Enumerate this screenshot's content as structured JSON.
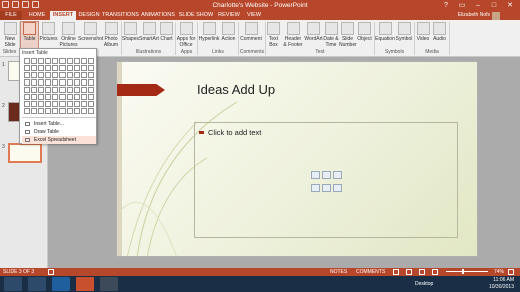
{
  "window": {
    "title": "Charlotte's Website - PowerPoint"
  },
  "tabs": [
    {
      "label": "FILE"
    },
    {
      "label": "HOME"
    },
    {
      "label": "INSERT"
    },
    {
      "label": "DESIGN"
    },
    {
      "label": "TRANSITIONS"
    },
    {
      "label": "ANIMATIONS"
    },
    {
      "label": "SLIDE SHOW"
    },
    {
      "label": "REVIEW"
    },
    {
      "label": "VIEW"
    }
  ],
  "active_tab": "INSERT",
  "user": {
    "name": "Elizabeth Nofs"
  },
  "ribbon": {
    "buttons": [
      {
        "label": "New\nSlide",
        "icon": "new-slide-icon"
      },
      {
        "label": "Table",
        "icon": "table-icon"
      },
      {
        "label": "Pictures",
        "icon": "pictures-icon"
      },
      {
        "label": "Online\nPictures",
        "icon": "online-pictures-icon"
      },
      {
        "label": "Screenshot",
        "icon": "screenshot-icon"
      },
      {
        "label": "Photo\nAlbum",
        "icon": "photo-album-icon"
      },
      {
        "label": "Shapes",
        "icon": "shapes-icon"
      },
      {
        "label": "SmartArt",
        "icon": "smartart-icon"
      },
      {
        "label": "Chart",
        "icon": "chart-icon"
      },
      {
        "label": "Apps for\nOffice",
        "icon": "apps-icon"
      },
      {
        "label": "Hyperlink",
        "icon": "hyperlink-icon"
      },
      {
        "label": "Action",
        "icon": "action-icon"
      },
      {
        "label": "Comment",
        "icon": "comment-icon"
      },
      {
        "label": "Text\nBox",
        "icon": "text-box-icon"
      },
      {
        "label": "Header\n& Footer",
        "icon": "header-footer-icon"
      },
      {
        "label": "WordArt",
        "icon": "wordart-icon"
      },
      {
        "label": "Date &\nTime",
        "icon": "date-time-icon"
      },
      {
        "label": "Slide\nNumber",
        "icon": "slide-number-icon"
      },
      {
        "label": "Object",
        "icon": "object-icon"
      },
      {
        "label": "Equation",
        "icon": "equation-icon"
      },
      {
        "label": "Symbol",
        "icon": "symbol-icon"
      },
      {
        "label": "Video",
        "icon": "video-icon"
      },
      {
        "label": "Audio",
        "icon": "audio-icon"
      }
    ],
    "groups": [
      {
        "label": "Slides"
      },
      {
        "label": "Images"
      },
      {
        "label": "Illustrations"
      },
      {
        "label": "Apps"
      },
      {
        "label": "Links"
      },
      {
        "label": "Comments"
      },
      {
        "label": "Text"
      },
      {
        "label": "Symbols"
      },
      {
        "label": "Media"
      }
    ]
  },
  "table_dropdown": {
    "header": "Insert Table",
    "grid_columns": 10,
    "grid_rows": 8,
    "items": [
      {
        "label": "Insert Table...",
        "icon": "insert-table-icon"
      },
      {
        "label": "Draw Table",
        "icon": "draw-table-icon"
      },
      {
        "label": "Excel Spreadsheet",
        "icon": "excel-spreadsheet-icon"
      }
    ]
  },
  "thumbnails": [
    {
      "number": "1"
    },
    {
      "number": "2"
    },
    {
      "number": "3"
    }
  ],
  "slide": {
    "title": "Ideas Add Up",
    "placeholder": "Click to add text"
  },
  "status": {
    "slide_count": "SLIDE 3 OF 3",
    "notes": "NOTES",
    "comments": "COMMENTS",
    "zoom": "74%"
  },
  "taskbar": {
    "desktop_label": "Desktop",
    "time": "11:06 AM",
    "date": "10/30/2013"
  },
  "colors": {
    "accent": "#b7472a",
    "slide_banner": "#a42a15",
    "taskbar": "#1a2f45"
  }
}
